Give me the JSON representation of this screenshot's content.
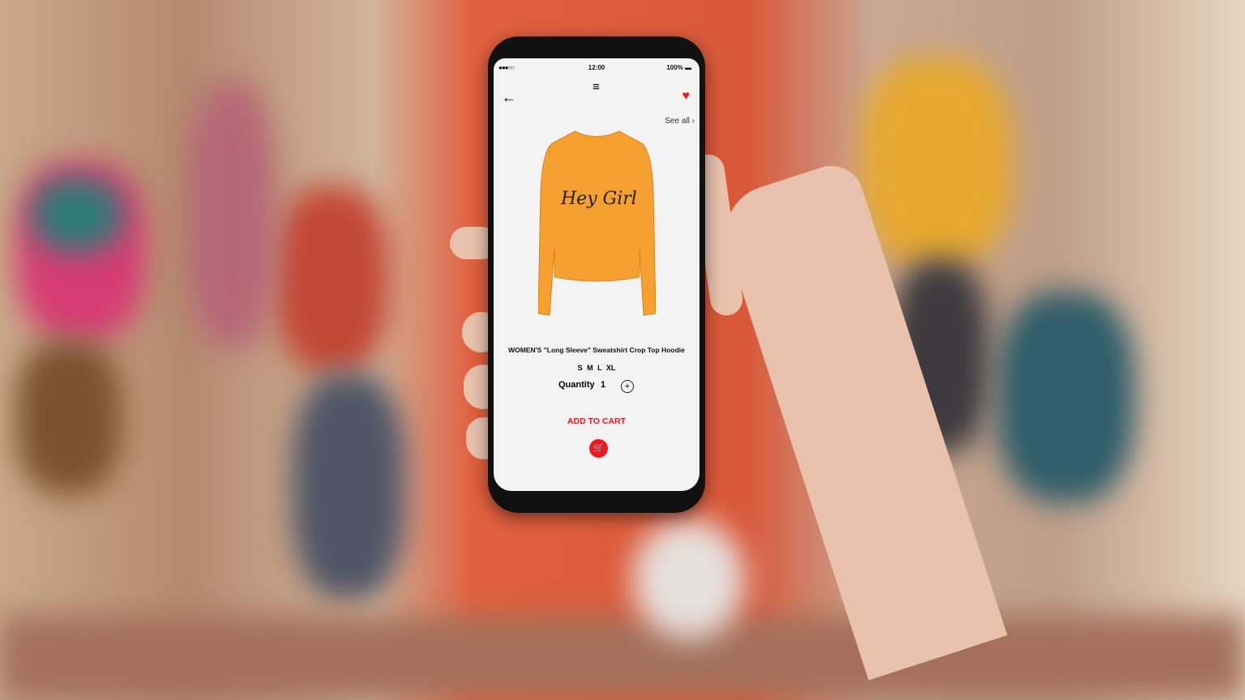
{
  "status_bar": {
    "signal": "●●●○○",
    "time": "12:00",
    "battery": "100% ▬"
  },
  "nav": {
    "menu_icon": "≡",
    "back_icon": "←",
    "favorite_icon": "♥",
    "see_all": "See all ›"
  },
  "product": {
    "print_text": "Hey Girl",
    "title": "WOMEN'S \"Long Sleeve\" Sweatshirt Crop Top Hoodie",
    "sizes": "S M L XL",
    "quantity_label": "Quantity",
    "quantity_value": "1",
    "plus_icon": "+"
  },
  "actions": {
    "add_to_cart": "ADD TO CART",
    "cart_icon": "🛒"
  },
  "colors": {
    "accent": "#f3161d",
    "sweater": "#f5a030"
  }
}
